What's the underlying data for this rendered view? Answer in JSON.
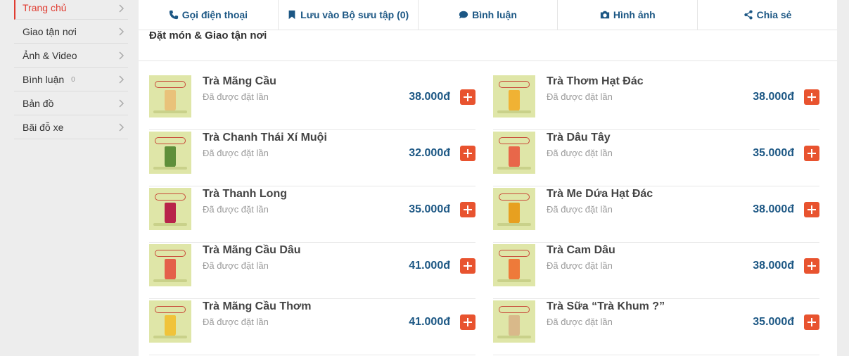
{
  "sidebar": {
    "items": [
      {
        "label": "Trang chủ"
      },
      {
        "label": "Giao tận nơi"
      },
      {
        "label": "Ảnh & Video"
      },
      {
        "label": "Bình luận",
        "count": "0"
      },
      {
        "label": "Bản đồ"
      },
      {
        "label": "Bãi đỗ xe"
      }
    ]
  },
  "actions": [
    {
      "label": "Gọi điện thoại",
      "icon": "phone-icon"
    },
    {
      "label": "Lưu vào Bộ sưu tập (0)",
      "icon": "bookmark-icon"
    },
    {
      "label": "Bình luận",
      "icon": "comment-icon"
    },
    {
      "label": "Hình ảnh",
      "icon": "camera-icon"
    },
    {
      "label": "Chia sẻ",
      "icon": "share-icon"
    }
  ],
  "section": {
    "title": "Đặt món & Giao tận nơi"
  },
  "menu": [
    {
      "name": "Trà Mãng Cầu",
      "ordered": "Đã được đặt lần",
      "price": "38.000đ",
      "color": "#e9c27a"
    },
    {
      "name": "Trà Thơm Hạt Đác",
      "ordered": "Đã được đặt lần",
      "price": "38.000đ",
      "color": "#f0b234"
    },
    {
      "name": "Trà Chanh Thái Xí Muội",
      "ordered": "Đã được đặt lần",
      "price": "32.000đ",
      "color": "#5f8f3a"
    },
    {
      "name": "Trà Dâu Tây",
      "ordered": "Đã được đặt lần",
      "price": "35.000đ",
      "color": "#e8674a"
    },
    {
      "name": "Trà Thanh Long",
      "ordered": "Đã được đặt lần",
      "price": "35.000đ",
      "color": "#b8244a"
    },
    {
      "name": "Trà Me Dứa Hạt Đác",
      "ordered": "Đã được đặt lần",
      "price": "38.000đ",
      "color": "#e7a020"
    },
    {
      "name": "Trà Mãng Cầu Dâu",
      "ordered": "Đã được đặt lần",
      "price": "41.000đ",
      "color": "#e4604a"
    },
    {
      "name": "Trà Cam Dâu",
      "ordered": "Đã được đặt lần",
      "price": "38.000đ",
      "color": "#ee7a3a"
    },
    {
      "name": "Trà Mãng Cầu Thơm",
      "ordered": "Đã được đặt lần",
      "price": "41.000đ",
      "color": "#f0c33a"
    },
    {
      "name": "Trà Sữa “Trà Khum ?”",
      "ordered": "Đã được đặt lần",
      "price": "35.000đ",
      "color": "#d9b98a"
    }
  ]
}
